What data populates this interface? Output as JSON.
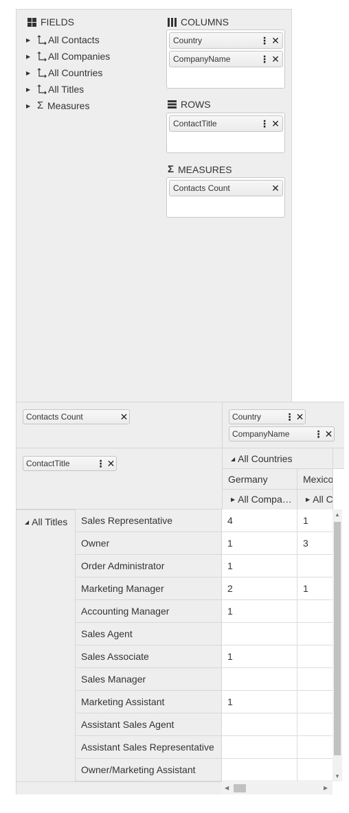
{
  "configurator": {
    "fields_title": "FIELDS",
    "fields": [
      {
        "label": "All Contacts",
        "kind": "hierarchy"
      },
      {
        "label": "All Companies",
        "kind": "hierarchy"
      },
      {
        "label": "All Countries",
        "kind": "hierarchy"
      },
      {
        "label": "All Titles",
        "kind": "hierarchy"
      },
      {
        "label": "Measures",
        "kind": "measures"
      }
    ],
    "columns_title": "COLUMNS",
    "columns": [
      "Country",
      "CompanyName"
    ],
    "rows_title": "ROWS",
    "rows": [
      "ContactTitle"
    ],
    "measures_title": "MEASURES",
    "measures": [
      "Contacts Count"
    ]
  },
  "grid": {
    "measure_chip": "Contacts Count",
    "column_chips": [
      "Country",
      "CompanyName"
    ],
    "row_chip": "ContactTitle",
    "col_root": "All Countries",
    "countries": [
      "Germany",
      "Mexico"
    ],
    "companies": [
      "All Compa…",
      "All C"
    ],
    "row_root": "All Titles",
    "rows": [
      {
        "title": "Sales Representative",
        "values": [
          "4",
          "1"
        ]
      },
      {
        "title": "Owner",
        "values": [
          "1",
          "3"
        ]
      },
      {
        "title": "Order Administrator",
        "values": [
          "1",
          ""
        ]
      },
      {
        "title": "Marketing Manager",
        "values": [
          "2",
          "1"
        ]
      },
      {
        "title": "Accounting Manager",
        "values": [
          "1",
          ""
        ]
      },
      {
        "title": "Sales Agent",
        "values": [
          "",
          ""
        ]
      },
      {
        "title": "Sales Associate",
        "values": [
          "1",
          ""
        ]
      },
      {
        "title": "Sales Manager",
        "values": [
          "",
          ""
        ]
      },
      {
        "title": "Marketing Assistant",
        "values": [
          "1",
          ""
        ]
      },
      {
        "title": "Assistant Sales Agent",
        "values": [
          "",
          ""
        ]
      },
      {
        "title": "Assistant Sales Representative",
        "values": [
          "",
          ""
        ]
      },
      {
        "title": "Owner/Marketing Assistant",
        "values": [
          "",
          ""
        ]
      }
    ]
  }
}
